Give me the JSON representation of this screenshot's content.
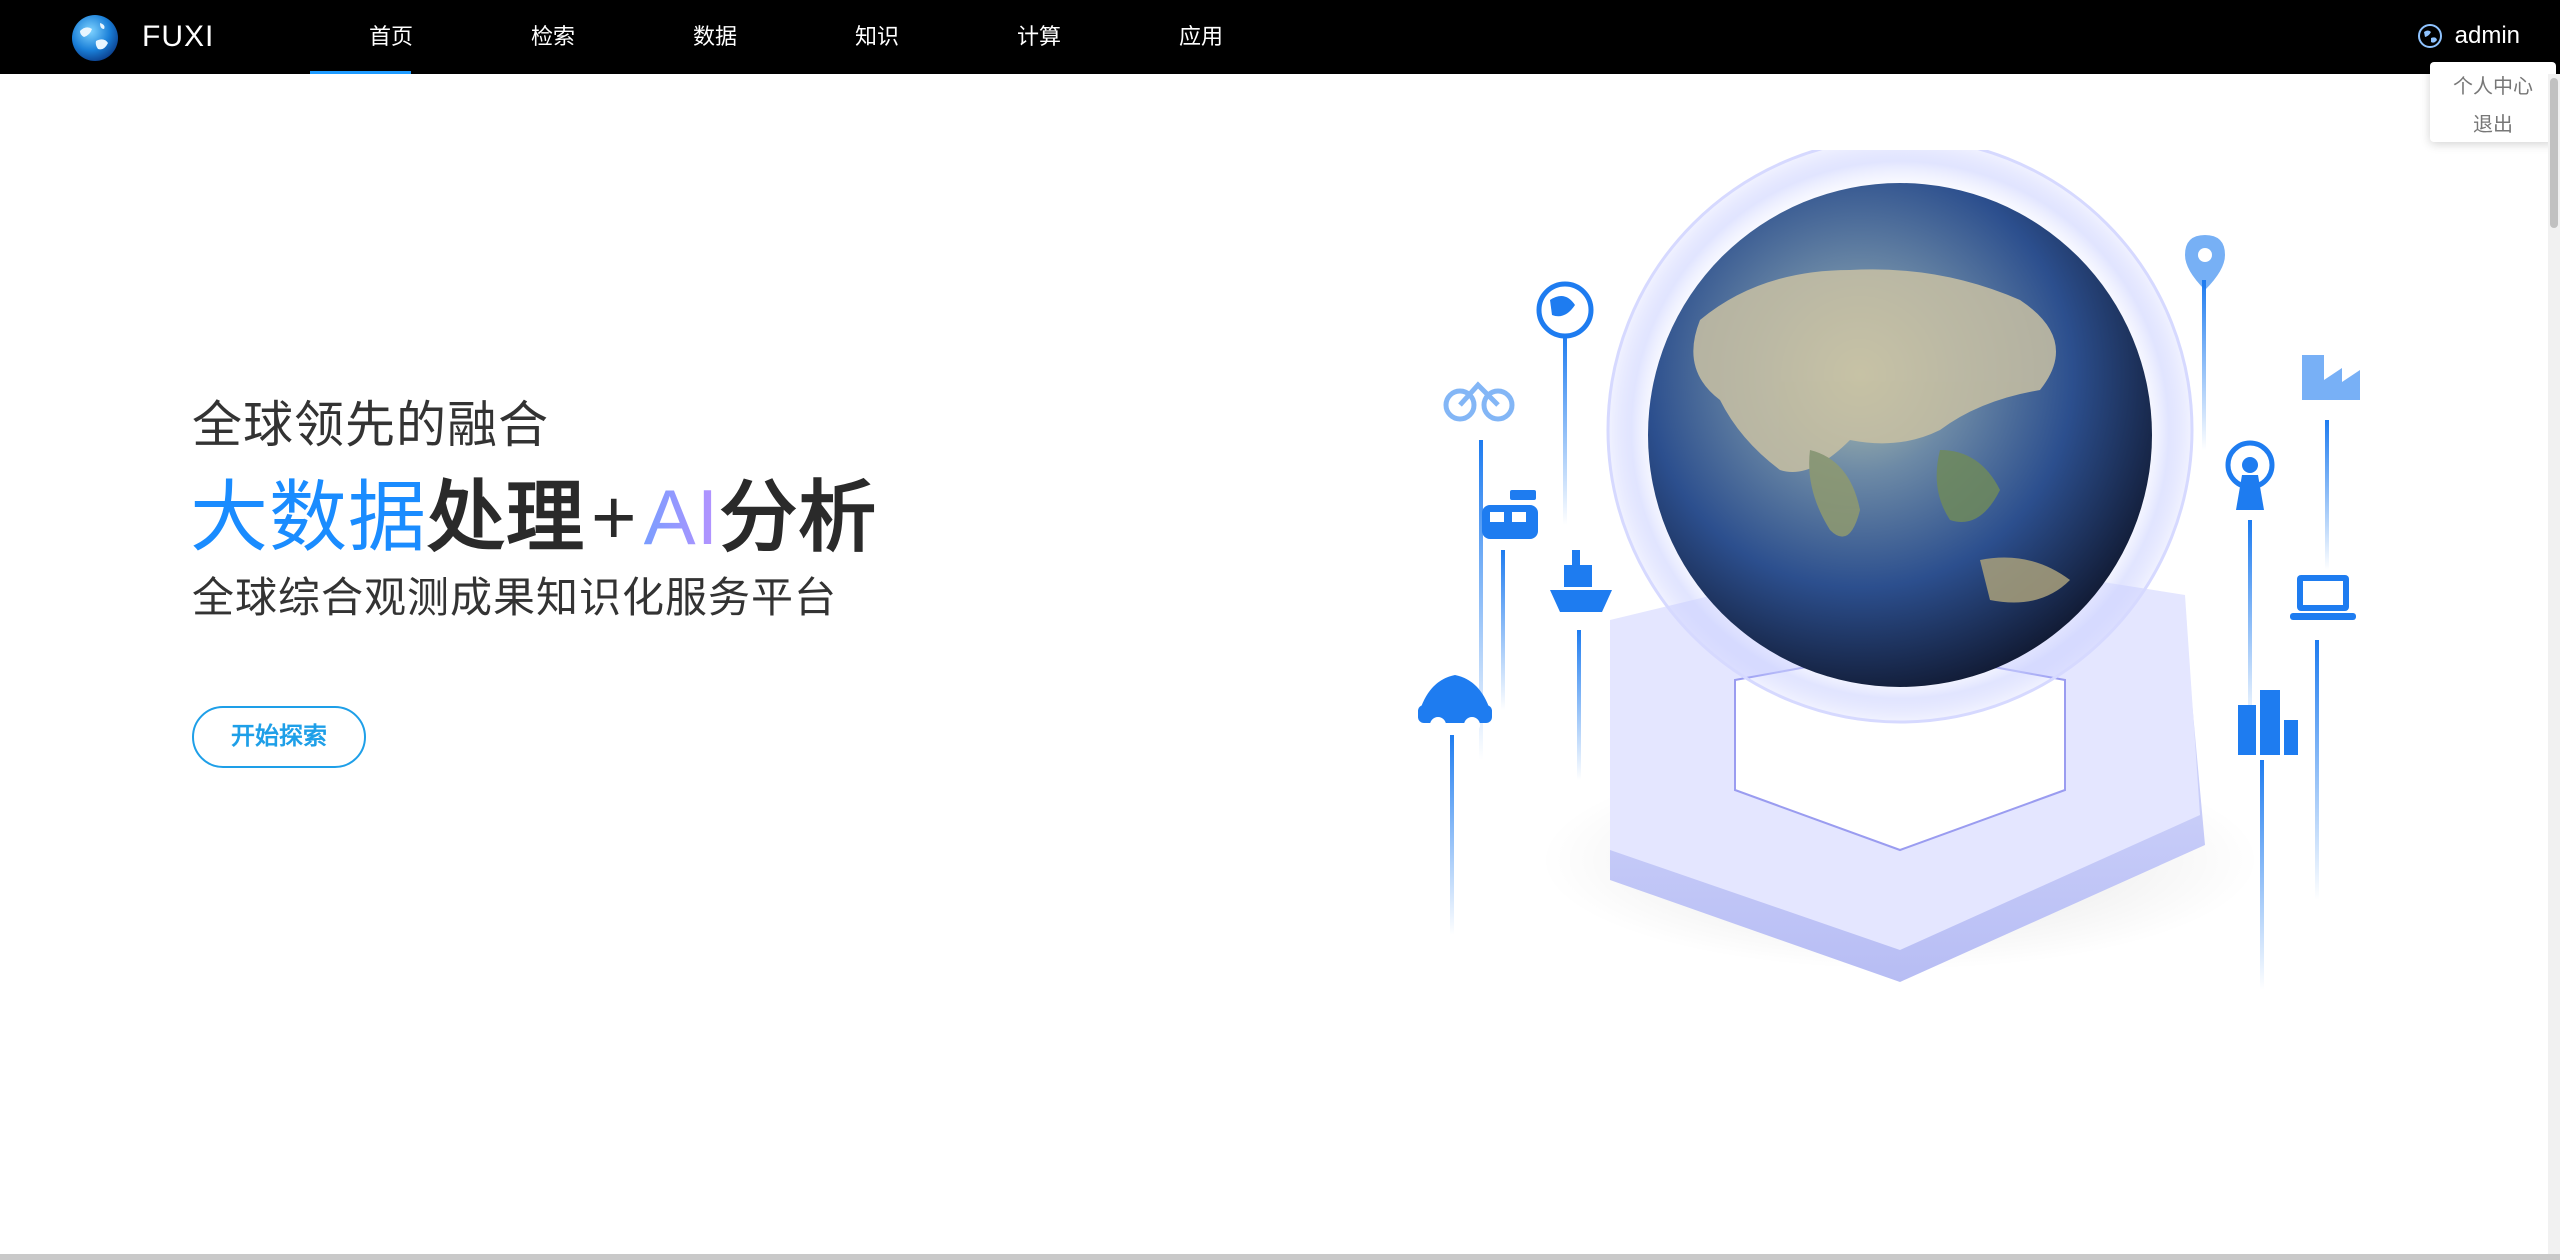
{
  "header": {
    "brand": "FUXI",
    "nav": [
      {
        "label": "首页",
        "active": true
      },
      {
        "label": "检索",
        "active": false
      },
      {
        "label": "数据",
        "active": false
      },
      {
        "label": "知识",
        "active": false
      },
      {
        "label": "计算",
        "active": false
      },
      {
        "label": "应用",
        "active": false
      }
    ],
    "user": "admin"
  },
  "user_menu": {
    "items": [
      "个人中心",
      "退出"
    ]
  },
  "hero": {
    "line1": "全球领先的融合",
    "line2": {
      "part1": "大数据",
      "part2": "处理",
      "plus": "+",
      "part3": "AI",
      "part4": "分析"
    },
    "line3": "全球综合观测成果知识化服务平台",
    "button": "开始探索"
  },
  "colors": {
    "topbar": "#000000",
    "accent": "#1e9bff",
    "button": "#1e9fe8",
    "text": "#333333"
  },
  "icons": [
    "globe-logo-icon",
    "user-globe-icon",
    "earth-globe-icon",
    "bicycle-icon",
    "train-icon",
    "ship-icon",
    "car-icon",
    "location-pin-icon",
    "factory-icon",
    "radio-tower-icon",
    "laptop-icon",
    "buildings-icon",
    "globe-plane-icon"
  ]
}
